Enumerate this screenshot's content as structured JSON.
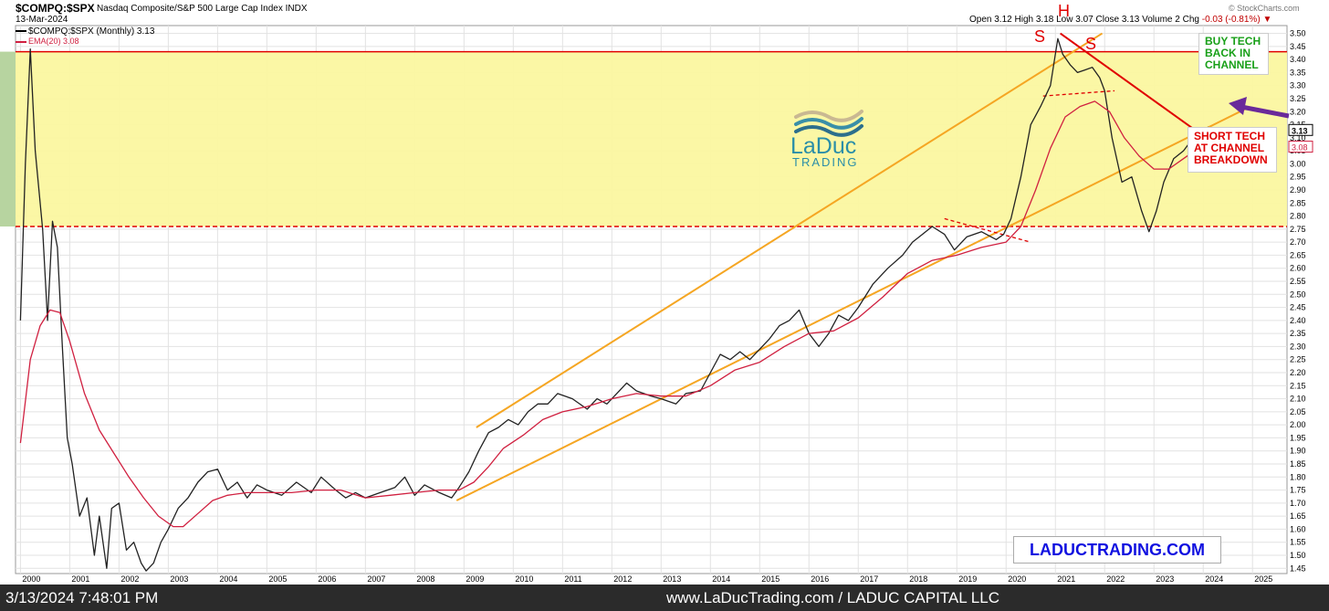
{
  "header": {
    "symbol": "$COMPQ:$SPX",
    "name": "Nasdaq Composite/S&P 500 Large Cap Index  INDX",
    "date": "13-Mar-2024",
    "source": "© StockCharts.com",
    "open_label": "Open",
    "open": "3.12",
    "high_label": "High",
    "high": "3.18",
    "low_label": "Low",
    "low": "3.07",
    "close_label": "Close",
    "close": "3.13",
    "volume_label": "Volume",
    "volume": "2",
    "chg_label": "Chg",
    "chg": "-0.03 (-0.81%)"
  },
  "legend": {
    "series1": "$COMPQ:$SPX (Monthly) 3.13",
    "series2": "EMA(20) 3.08"
  },
  "annotations": {
    "buy": [
      "BUY TECH",
      "BACK IN",
      "CHANNEL"
    ],
    "short": [
      "SHORT TECH",
      "AT CHANNEL",
      "BREAKDOWN"
    ],
    "website_box": "LADUCTRADING.COM",
    "logo_top": "LaDuc",
    "logo_bottom": "TRADING",
    "head_label": "H",
    "shoulder_label": "S",
    "last_price_tag": "3.13",
    "ema_tag": "3.08"
  },
  "footer": {
    "timestamp": "3/13/2024 7:48:01 PM",
    "site": "www.LaDucTrading.com / LADUC CAPITAL LLC"
  },
  "colors": {
    "price": "#222222",
    "ema": "#d02040",
    "channel": "#f5a623",
    "zone": "#fbf7a0",
    "resistance": "#e00000",
    "arrow": "#6a2a9a",
    "buy_text": "#19a019",
    "short_text": "#e00000"
  },
  "chart_data": {
    "type": "line",
    "title": "$COMPQ:$SPX",
    "x_ticks": [
      "2000",
      "2001",
      "2002",
      "2003",
      "2004",
      "2005",
      "2006",
      "2007",
      "2008",
      "2009",
      "2010",
      "2011",
      "2012",
      "2013",
      "2014",
      "2015",
      "2016",
      "2017",
      "2018",
      "2019",
      "2020",
      "2021",
      "2022",
      "2023",
      "2024",
      "2025"
    ],
    "y_ticks": [
      "3.50",
      "3.45",
      "3.40",
      "3.35",
      "3.30",
      "3.25",
      "3.20",
      "3.15",
      "3.10",
      "3.05",
      "3.00",
      "2.95",
      "2.90",
      "2.85",
      "2.80",
      "2.75",
      "2.70",
      "2.65",
      "2.60",
      "2.55",
      "2.50",
      "2.45",
      "2.40",
      "2.35",
      "2.30",
      "2.25",
      "2.20",
      "2.15",
      "2.10",
      "2.05",
      "2.00",
      "1.95",
      "1.90",
      "1.85",
      "1.80",
      "1.75",
      "1.70",
      "1.65",
      "1.60",
      "1.55",
      "1.50",
      "1.45"
    ],
    "xlim": [
      1999.9,
      2025.7
    ],
    "ylim": [
      1.43,
      3.53
    ],
    "grid": true,
    "series": [
      {
        "name": "$COMPQ:$SPX (Monthly)",
        "points": [
          [
            2000.0,
            2.4
          ],
          [
            2000.1,
            3.0
          ],
          [
            2000.2,
            3.44
          ],
          [
            2000.3,
            3.05
          ],
          [
            2000.45,
            2.75
          ],
          [
            2000.55,
            2.4
          ],
          [
            2000.65,
            2.78
          ],
          [
            2000.75,
            2.68
          ],
          [
            2000.85,
            2.3
          ],
          [
            2000.95,
            1.95
          ],
          [
            2001.05,
            1.85
          ],
          [
            2001.2,
            1.65
          ],
          [
            2001.35,
            1.72
          ],
          [
            2001.5,
            1.5
          ],
          [
            2001.6,
            1.65
          ],
          [
            2001.75,
            1.45
          ],
          [
            2001.85,
            1.68
          ],
          [
            2002.0,
            1.7
          ],
          [
            2002.15,
            1.52
          ],
          [
            2002.3,
            1.55
          ],
          [
            2002.45,
            1.47
          ],
          [
            2002.55,
            1.44
          ],
          [
            2002.7,
            1.47
          ],
          [
            2002.85,
            1.55
          ],
          [
            2003.0,
            1.6
          ],
          [
            2003.2,
            1.68
          ],
          [
            2003.4,
            1.72
          ],
          [
            2003.6,
            1.78
          ],
          [
            2003.8,
            1.82
          ],
          [
            2004.0,
            1.83
          ],
          [
            2004.2,
            1.75
          ],
          [
            2004.4,
            1.78
          ],
          [
            2004.6,
            1.72
          ],
          [
            2004.8,
            1.77
          ],
          [
            2005.0,
            1.75
          ],
          [
            2005.3,
            1.73
          ],
          [
            2005.6,
            1.78
          ],
          [
            2005.9,
            1.74
          ],
          [
            2006.1,
            1.8
          ],
          [
            2006.4,
            1.75
          ],
          [
            2006.6,
            1.72
          ],
          [
            2006.8,
            1.74
          ],
          [
            2007.0,
            1.72
          ],
          [
            2007.3,
            1.74
          ],
          [
            2007.6,
            1.76
          ],
          [
            2007.8,
            1.8
          ],
          [
            2008.0,
            1.73
          ],
          [
            2008.2,
            1.77
          ],
          [
            2008.5,
            1.74
          ],
          [
            2008.75,
            1.72
          ],
          [
            2008.9,
            1.76
          ],
          [
            2009.1,
            1.82
          ],
          [
            2009.3,
            1.9
          ],
          [
            2009.5,
            1.97
          ],
          [
            2009.7,
            1.99
          ],
          [
            2009.9,
            2.02
          ],
          [
            2010.1,
            2.0
          ],
          [
            2010.3,
            2.05
          ],
          [
            2010.5,
            2.08
          ],
          [
            2010.7,
            2.08
          ],
          [
            2010.9,
            2.12
          ],
          [
            2011.2,
            2.1
          ],
          [
            2011.5,
            2.06
          ],
          [
            2011.7,
            2.1
          ],
          [
            2011.9,
            2.08
          ],
          [
            2012.1,
            2.12
          ],
          [
            2012.3,
            2.16
          ],
          [
            2012.5,
            2.13
          ],
          [
            2012.8,
            2.11
          ],
          [
            2013.0,
            2.1
          ],
          [
            2013.3,
            2.08
          ],
          [
            2013.5,
            2.12
          ],
          [
            2013.8,
            2.13
          ],
          [
            2014.0,
            2.2
          ],
          [
            2014.2,
            2.27
          ],
          [
            2014.4,
            2.25
          ],
          [
            2014.6,
            2.28
          ],
          [
            2014.8,
            2.25
          ],
          [
            2015.0,
            2.29
          ],
          [
            2015.2,
            2.33
          ],
          [
            2015.4,
            2.38
          ],
          [
            2015.6,
            2.4
          ],
          [
            2015.8,
            2.44
          ],
          [
            2016.0,
            2.35
          ],
          [
            2016.2,
            2.3
          ],
          [
            2016.4,
            2.35
          ],
          [
            2016.6,
            2.42
          ],
          [
            2016.8,
            2.4
          ],
          [
            2017.0,
            2.45
          ],
          [
            2017.3,
            2.54
          ],
          [
            2017.6,
            2.6
          ],
          [
            2017.9,
            2.65
          ],
          [
            2018.1,
            2.7
          ],
          [
            2018.3,
            2.73
          ],
          [
            2018.5,
            2.76
          ],
          [
            2018.75,
            2.73
          ],
          [
            2018.95,
            2.67
          ],
          [
            2019.2,
            2.72
          ],
          [
            2019.5,
            2.74
          ],
          [
            2019.8,
            2.71
          ],
          [
            2019.95,
            2.73
          ],
          [
            2020.1,
            2.79
          ],
          [
            2020.3,
            2.95
          ],
          [
            2020.5,
            3.15
          ],
          [
            2020.7,
            3.22
          ],
          [
            2020.9,
            3.3
          ],
          [
            2021.05,
            3.48
          ],
          [
            2021.15,
            3.42
          ],
          [
            2021.3,
            3.38
          ],
          [
            2021.45,
            3.35
          ],
          [
            2021.6,
            3.36
          ],
          [
            2021.75,
            3.37
          ],
          [
            2021.9,
            3.33
          ],
          [
            2022.0,
            3.28
          ],
          [
            2022.15,
            3.1
          ],
          [
            2022.35,
            2.93
          ],
          [
            2022.55,
            2.95
          ],
          [
            2022.75,
            2.82
          ],
          [
            2022.9,
            2.74
          ],
          [
            2023.05,
            2.82
          ],
          [
            2023.2,
            2.93
          ],
          [
            2023.4,
            3.02
          ],
          [
            2023.6,
            3.05
          ],
          [
            2023.8,
            3.1
          ],
          [
            2023.95,
            3.13
          ],
          [
            2024.1,
            3.14
          ],
          [
            2024.2,
            3.13
          ]
        ]
      },
      {
        "name": "EMA(20)",
        "points": [
          [
            2000.0,
            1.93
          ],
          [
            2000.2,
            2.25
          ],
          [
            2000.4,
            2.38
          ],
          [
            2000.6,
            2.44
          ],
          [
            2000.8,
            2.43
          ],
          [
            2001.0,
            2.32
          ],
          [
            2001.3,
            2.12
          ],
          [
            2001.6,
            1.98
          ],
          [
            2001.9,
            1.89
          ],
          [
            2002.2,
            1.8
          ],
          [
            2002.5,
            1.72
          ],
          [
            2002.8,
            1.65
          ],
          [
            2003.1,
            1.61
          ],
          [
            2003.3,
            1.61
          ],
          [
            2003.6,
            1.66
          ],
          [
            2003.9,
            1.71
          ],
          [
            2004.2,
            1.73
          ],
          [
            2004.6,
            1.74
          ],
          [
            2005.0,
            1.74
          ],
          [
            2005.5,
            1.74
          ],
          [
            2006.0,
            1.75
          ],
          [
            2006.5,
            1.75
          ],
          [
            2007.0,
            1.72
          ],
          [
            2007.5,
            1.73
          ],
          [
            2008.0,
            1.74
          ],
          [
            2008.5,
            1.75
          ],
          [
            2008.9,
            1.75
          ],
          [
            2009.2,
            1.78
          ],
          [
            2009.5,
            1.84
          ],
          [
            2009.8,
            1.91
          ],
          [
            2010.2,
            1.96
          ],
          [
            2010.6,
            2.02
          ],
          [
            2011.0,
            2.05
          ],
          [
            2011.5,
            2.07
          ],
          [
            2012.0,
            2.1
          ],
          [
            2012.5,
            2.12
          ],
          [
            2013.0,
            2.11
          ],
          [
            2013.5,
            2.11
          ],
          [
            2014.0,
            2.15
          ],
          [
            2014.5,
            2.21
          ],
          [
            2015.0,
            2.24
          ],
          [
            2015.5,
            2.3
          ],
          [
            2016.0,
            2.35
          ],
          [
            2016.5,
            2.36
          ],
          [
            2017.0,
            2.41
          ],
          [
            2017.5,
            2.49
          ],
          [
            2018.0,
            2.58
          ],
          [
            2018.5,
            2.63
          ],
          [
            2019.0,
            2.65
          ],
          [
            2019.5,
            2.68
          ],
          [
            2020.0,
            2.7
          ],
          [
            2020.3,
            2.76
          ],
          [
            2020.6,
            2.9
          ],
          [
            2020.9,
            3.06
          ],
          [
            2021.2,
            3.18
          ],
          [
            2021.5,
            3.22
          ],
          [
            2021.8,
            3.24
          ],
          [
            2022.1,
            3.2
          ],
          [
            2022.4,
            3.1
          ],
          [
            2022.7,
            3.03
          ],
          [
            2023.0,
            2.98
          ],
          [
            2023.3,
            2.98
          ],
          [
            2023.6,
            3.02
          ],
          [
            2023.9,
            3.06
          ],
          [
            2024.2,
            3.08
          ]
        ]
      }
    ]
  }
}
